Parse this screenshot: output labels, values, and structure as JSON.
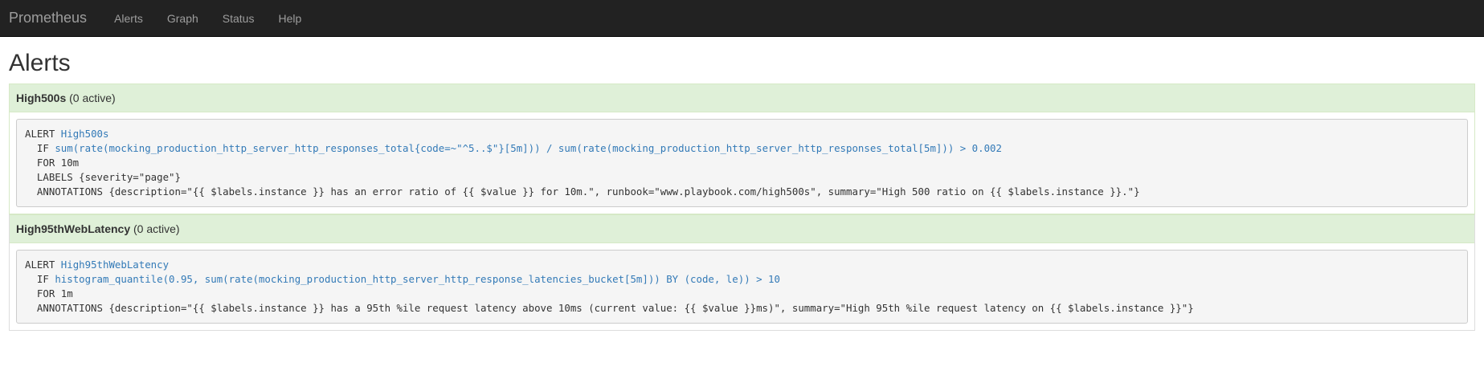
{
  "navbar": {
    "brand": "Prometheus",
    "links": [
      "Alerts",
      "Graph",
      "Status",
      "Help"
    ]
  },
  "page": {
    "title": "Alerts"
  },
  "alerts": [
    {
      "name": "High500s",
      "active_label": "(0 active)",
      "rule": {
        "alert_kw": "ALERT",
        "alert_name": "High500s",
        "if_kw": "IF",
        "expr": "sum(rate(mocking_production_http_server_http_responses_total{code=~\"^5..$\"}[5m])) / sum(rate(mocking_production_http_server_http_responses_total[5m])) > 0.002",
        "for_line": "FOR 10m",
        "labels_line": "LABELS {severity=\"page\"}",
        "annotations_line": "ANNOTATIONS {description=\"{{ $labels.instance }} has an error ratio of {{ $value }} for 10m.\", runbook=\"www.playbook.com/high500s\", summary=\"High 500 ratio on {{ $labels.instance }}.\"}"
      }
    },
    {
      "name": "High95thWebLatency",
      "active_label": "(0 active)",
      "rule": {
        "alert_kw": "ALERT",
        "alert_name": "High95thWebLatency",
        "if_kw": "IF",
        "expr": "histogram_quantile(0.95, sum(rate(mocking_production_http_server_http_response_latencies_bucket[5m])) BY (code, le)) > 10",
        "for_line": "FOR 1m",
        "annotations_line": "ANNOTATIONS {description=\"{{ $labels.instance }} has a 95th %ile request latency above 10ms (current value: {{ $value }}ms)\", summary=\"High 95th %ile request latency on {{ $labels.instance }}\"}"
      }
    }
  ],
  "colors": {
    "navbar_bg": "#222222",
    "nav_text": "#9d9d9d",
    "panel_heading_bg": "#dff0d8",
    "link": "#337ab7",
    "code_bg": "#f5f5f5"
  }
}
